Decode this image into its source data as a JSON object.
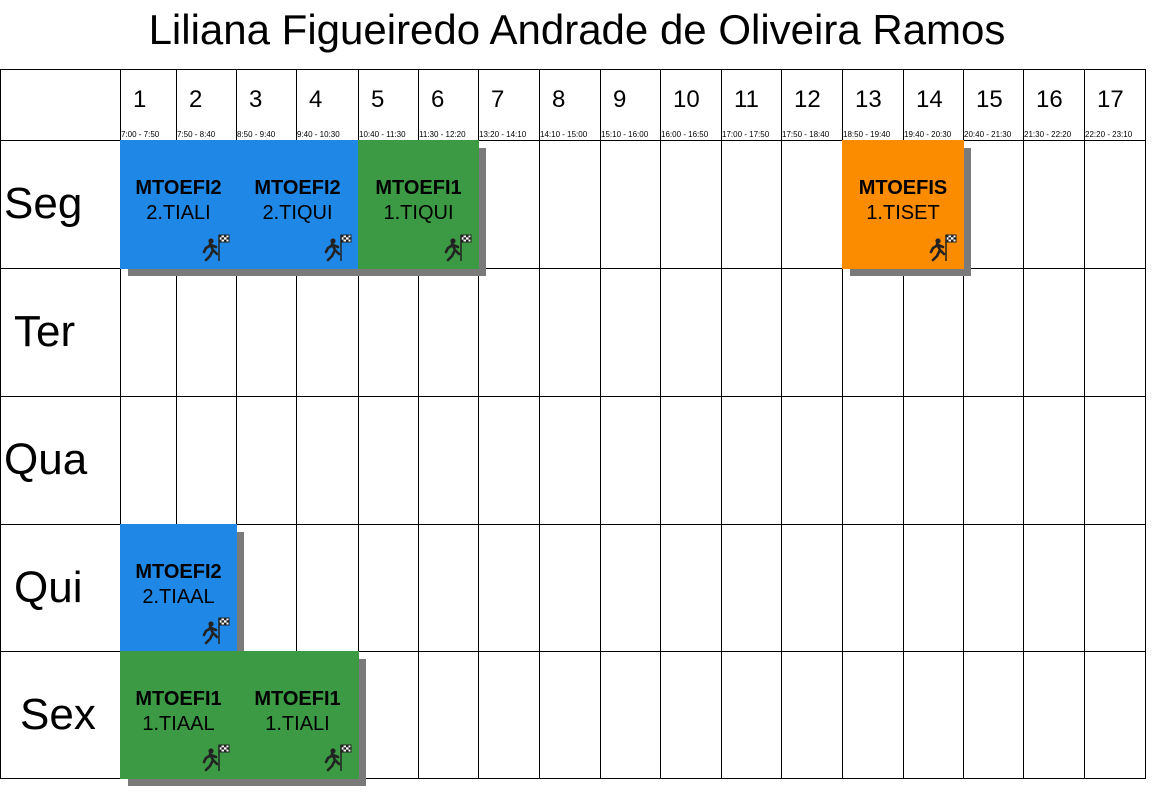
{
  "title": "Liliana Figueiredo Andrade de Oliveira Ramos",
  "periods": [
    {
      "num": "1",
      "time": "7:00 - 7:50"
    },
    {
      "num": "2",
      "time": "7:50 - 8:40"
    },
    {
      "num": "3",
      "time": "8:50 - 9:40"
    },
    {
      "num": "4",
      "time": "9:40 - 10:30"
    },
    {
      "num": "5",
      "time": "10:40 - 11:30"
    },
    {
      "num": "6",
      "time": "11:30 - 12:20"
    },
    {
      "num": "7",
      "time": "13:20 - 14:10"
    },
    {
      "num": "8",
      "time": "14:10 - 15:00"
    },
    {
      "num": "9",
      "time": "15:10 - 16:00"
    },
    {
      "num": "10",
      "time": "16:00 - 16:50"
    },
    {
      "num": "11",
      "time": "17:00 - 17:50"
    },
    {
      "num": "12",
      "time": "17:50 - 18:40"
    },
    {
      "num": "13",
      "time": "18:50 - 19:40"
    },
    {
      "num": "14",
      "time": "19:40 - 20:30"
    },
    {
      "num": "15",
      "time": "20:40 - 21:30"
    },
    {
      "num": "16",
      "time": "21:30 - 22:20"
    },
    {
      "num": "17",
      "time": "22:20 - 23:10"
    }
  ],
  "days": [
    "Seg",
    "Ter",
    "Qua",
    "Qui",
    "Sex"
  ],
  "colors": {
    "blue": "#1f88e6",
    "green": "#3b9a43",
    "orange": "#fb8c00",
    "shadow": "#7a7a7a"
  },
  "icon": "runner-finish-flag-icon",
  "blocks": [
    {
      "day": 0,
      "start": 1,
      "span": 2,
      "code": "MTOEFI2",
      "group": "2.TIALI",
      "color": "blue"
    },
    {
      "day": 0,
      "start": 3,
      "span": 2,
      "code": "MTOEFI2",
      "group": "2.TIQUI",
      "color": "blue"
    },
    {
      "day": 0,
      "start": 5,
      "span": 2,
      "code": "MTOEFI1",
      "group": "1.TIQUI",
      "color": "green"
    },
    {
      "day": 0,
      "start": 13,
      "span": 2,
      "code": "MTOEFIS",
      "group": "1.TISET",
      "color": "orange"
    },
    {
      "day": 3,
      "start": 1,
      "span": 2,
      "code": "MTOEFI2",
      "group": "2.TIAAL",
      "color": "blue"
    },
    {
      "day": 4,
      "start": 1,
      "span": 2,
      "code": "MTOEFI1",
      "group": "1.TIAAL",
      "color": "green"
    },
    {
      "day": 4,
      "start": 3,
      "span": 2,
      "code": "MTOEFI1",
      "group": "1.TIALI",
      "color": "green"
    }
  ]
}
